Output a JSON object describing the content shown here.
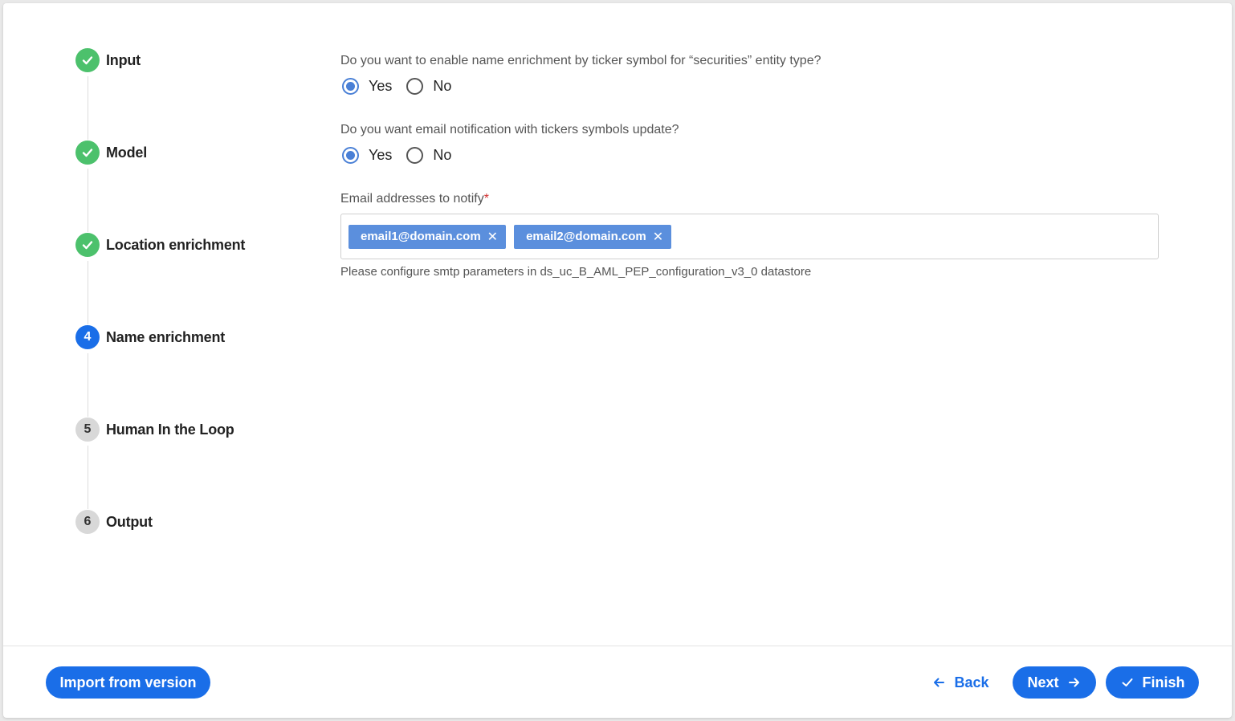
{
  "stepper": {
    "steps": [
      {
        "label": "Input",
        "state": "done",
        "marker": ""
      },
      {
        "label": "Model",
        "state": "done",
        "marker": ""
      },
      {
        "label": "Location enrichment",
        "state": "done",
        "marker": ""
      },
      {
        "label": "Name enrichment",
        "state": "active",
        "marker": "4"
      },
      {
        "label": "Human In the Loop",
        "state": "pending",
        "marker": "5"
      },
      {
        "label": "Output",
        "state": "pending",
        "marker": "6"
      }
    ]
  },
  "form": {
    "q1": {
      "text": "Do you want to enable name enrichment by ticker symbol for “securities” entity type?",
      "yes": "Yes",
      "no": "No",
      "selected": "Yes"
    },
    "q2": {
      "text": "Do you want email notification with tickers symbols update?",
      "yes": "Yes",
      "no": "No",
      "selected": "Yes"
    },
    "emails": {
      "label": "Email addresses to notify",
      "required_mark": "*",
      "chips": [
        "email1@domain.com",
        "email2@domain.com"
      ],
      "hint": "Please configure smtp parameters in ds_uc_B_AML_PEP_configuration_v3_0 datastore"
    }
  },
  "footer": {
    "import_label": "Import from version",
    "back_label": "Back",
    "next_label": "Next",
    "finish_label": "Finish"
  },
  "colors": {
    "primary": "#1a6ee8",
    "done": "#4cc16c",
    "chip": "#5b8fdd",
    "pending": "#d8d8d8"
  }
}
